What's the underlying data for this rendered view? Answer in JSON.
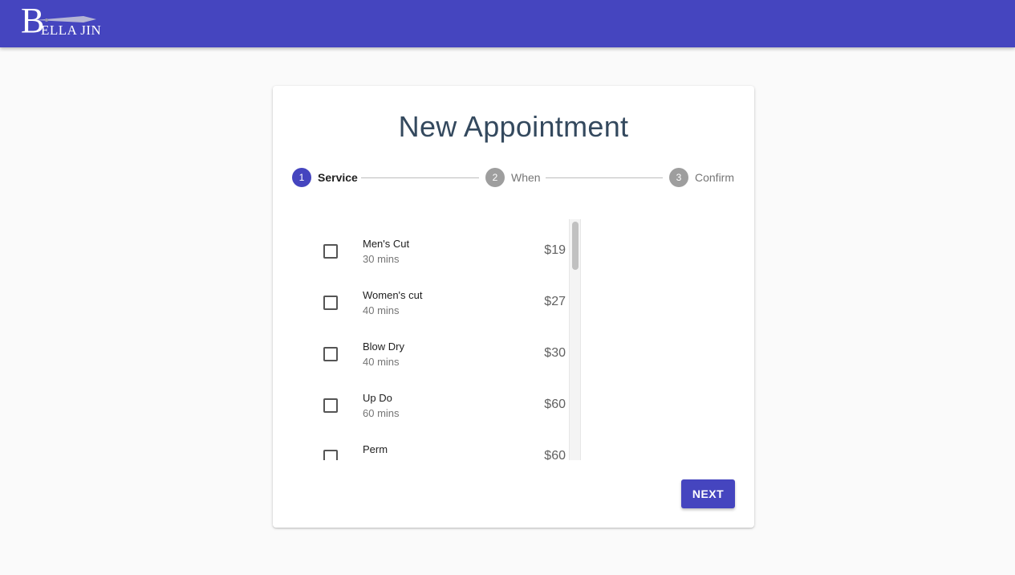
{
  "header": {
    "brand": {
      "initial": "B",
      "rest": "ELLA JIN"
    },
    "color": "#4545bf"
  },
  "card": {
    "title": "New Appointment"
  },
  "stepper": {
    "steps": [
      {
        "number": "1",
        "label": "Service",
        "state": "active",
        "color": "#4545bf"
      },
      {
        "number": "2",
        "label": "When",
        "state": "inactive",
        "color": "#9e9e9e"
      },
      {
        "number": "3",
        "label": "Confirm",
        "state": "inactive",
        "color": "#9e9e9e"
      }
    ]
  },
  "services": [
    {
      "name": "Men's Cut",
      "duration": "30 mins",
      "price": "$19",
      "checked": false
    },
    {
      "name": "Women's cut",
      "duration": "40 mins",
      "price": "$27",
      "checked": false
    },
    {
      "name": "Blow Dry",
      "duration": "40 mins",
      "price": "$30",
      "checked": false
    },
    {
      "name": "Up Do",
      "duration": "60 mins",
      "price": "$60",
      "checked": false
    },
    {
      "name": "Perm",
      "duration": "",
      "price": "$60",
      "checked": false
    }
  ],
  "actions": {
    "next_label": "NEXT"
  }
}
